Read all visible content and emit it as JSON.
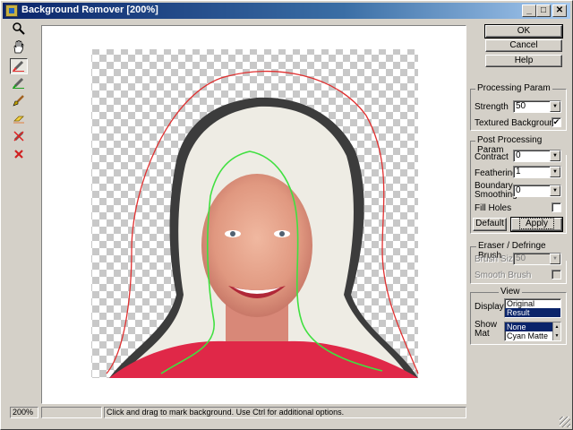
{
  "window": {
    "title": "Background Remover [200%]"
  },
  "titlebar_buttons": {
    "minimize": "_",
    "maximize": "□",
    "close": "✕"
  },
  "tools": [
    {
      "name": "zoom-icon",
      "glyph": "🔍"
    },
    {
      "name": "hand-icon",
      "glyph": "✋"
    },
    {
      "name": "mark-background-pen-icon",
      "glyph": "✎"
    },
    {
      "name": "mark-foreground-pen-icon",
      "glyph": "✎"
    },
    {
      "name": "brush-icon",
      "glyph": "🖌"
    },
    {
      "name": "eraser-icon",
      "glyph": "▰"
    },
    {
      "name": "clear-marks-icon",
      "glyph": "✗"
    },
    {
      "name": "delete-icon",
      "glyph": "✕"
    }
  ],
  "colors": {
    "background_mark": "#e03030",
    "foreground_mark": "#40e040",
    "selection": "#0a246a"
  },
  "buttons": {
    "ok": "OK",
    "cancel": "Cancel",
    "help": "Help"
  },
  "processing": {
    "title": "Processing Param",
    "strength_label": "Strength",
    "strength_value": "50",
    "textured_label": "Textured Background",
    "textured_checked": "✔"
  },
  "post": {
    "title": "Post Processing Param",
    "contract_label": "Contract",
    "contract_value": "0",
    "feathering_label": "Feathering",
    "feathering_value": "1",
    "boundary_label_1": "Boundary",
    "boundary_label_2": "Smoothing",
    "boundary_value": "0",
    "fill_holes_label": "Fill Holes",
    "default_button": "Default",
    "apply_button": "Apply"
  },
  "eraser": {
    "title": "Eraser / Defringe  Brush",
    "brush_size_label": "Brush Size",
    "brush_size_value": "50",
    "smooth_label": "Smooth Brush"
  },
  "view": {
    "title": "View",
    "display_label": "Display",
    "display_options": [
      "Original",
      "Result"
    ],
    "display_selected": "Result",
    "show_mat_label_1": "Show",
    "show_mat_label_2": "Mat",
    "show_mat_options": [
      "None",
      "Cyan Matte"
    ],
    "show_mat_selected": "None"
  },
  "status": {
    "zoom": "200%",
    "hint": "Click and drag to mark background. Use Ctrl for additional options."
  }
}
